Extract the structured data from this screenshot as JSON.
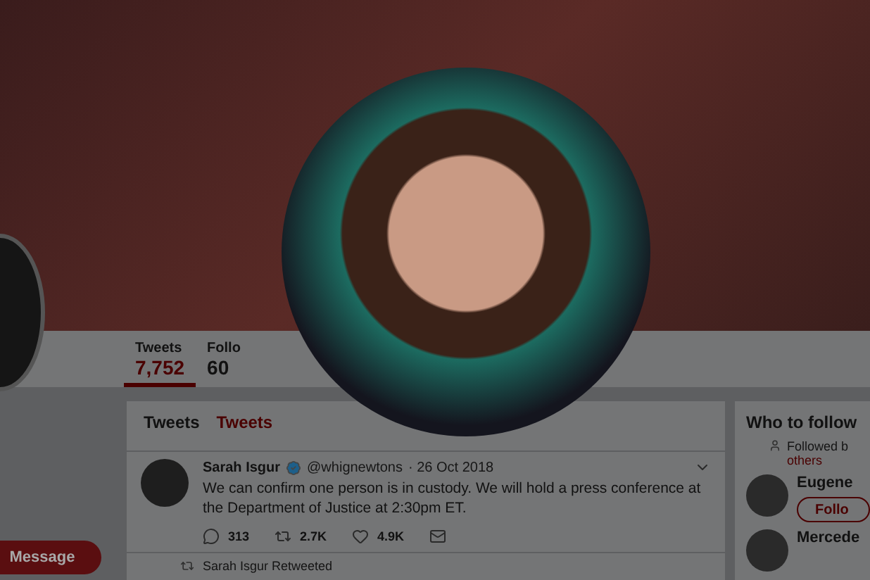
{
  "stats": [
    {
      "label": "Tweets",
      "value": "7,752",
      "selected": true
    },
    {
      "label": "Follo",
      "value": "60",
      "selected": false
    }
  ],
  "message_button": "Message",
  "timeline": {
    "tabs": [
      {
        "label": "Tweets",
        "selected": true
      },
      {
        "label": "Tweets",
        "selected": false
      }
    ],
    "tweet": {
      "name": "Sarah Isgur",
      "verified": true,
      "handle": "@whignewtons",
      "date": "· 26 Oct 2018",
      "text": "We can confirm one person is in custody. We will hold a press conference at the Department of Justice at 2:30pm ET.",
      "replies": "313",
      "retweets": "2.7K",
      "likes": "4.9K"
    },
    "retweet_note": "Sarah Isgur Retweeted"
  },
  "who_to_follow": {
    "title": "Who to follow",
    "followed_by": "Followed b",
    "followed_by_more": "others",
    "accounts": [
      {
        "name": "Eugene",
        "button": "Follo"
      },
      {
        "name": "Mercede"
      }
    ]
  }
}
